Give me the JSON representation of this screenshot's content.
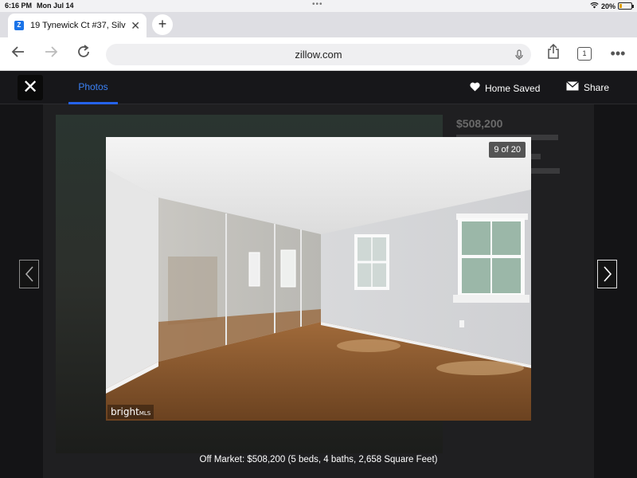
{
  "status_bar": {
    "time": "6:16 PM",
    "date": "Mon Jul 14",
    "battery": "20%",
    "battery_level": 0.2
  },
  "browser": {
    "tab_title": "19 Tynewick Ct #37, Silv",
    "url": "zillow.com",
    "tab_count": "1"
  },
  "viewer": {
    "photos_tab": "Photos",
    "saved_label": "Home Saved",
    "share_label": "Share",
    "counter": "9 of 20",
    "mls_logo_text": "bright",
    "mls_logo_suffix": "MLS",
    "caption": "Off Market: $508,200 (5 beds, 4 baths, 2,658 Square Feet)"
  },
  "background_listing": {
    "price": "$508,200"
  },
  "icons": {
    "close": "close-icon",
    "back": "back-arrow-icon",
    "forward": "forward-arrow-icon",
    "reload": "reload-icon",
    "share": "share-icon",
    "more": "more-icon",
    "mic": "microphone-icon",
    "heart": "heart-icon",
    "mail": "envelope-icon",
    "wifi": "wifi-icon",
    "battery": "battery-icon",
    "prev": "chevron-left-icon",
    "next": "chevron-right-icon"
  },
  "colors": {
    "accent": "#2563eb",
    "overlay": "#17171a"
  }
}
